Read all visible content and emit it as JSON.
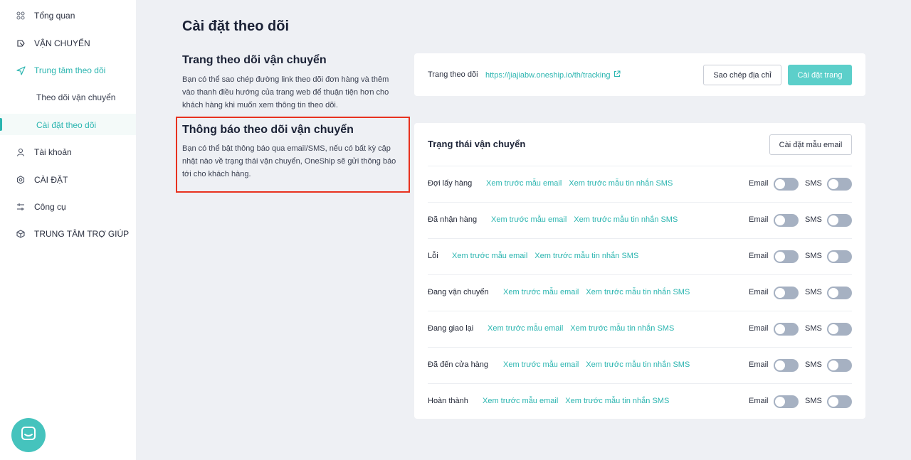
{
  "sidebar": {
    "items": [
      {
        "label": "Tổng quan",
        "icon": "grid-icon"
      },
      {
        "label": "VẬN CHUYỂN",
        "icon": "truck-icon"
      },
      {
        "label": "Trung tâm theo dõi",
        "icon": "send-icon"
      },
      {
        "label": "Tài khoản",
        "icon": "user-icon"
      },
      {
        "label": "CÀI ĐẶT",
        "icon": "settings-icon"
      },
      {
        "label": "Công cụ",
        "icon": "tools-icon"
      },
      {
        "label": "TRUNG TÂM TRỢ GIÚP",
        "icon": "box-icon"
      }
    ],
    "sub_items": [
      {
        "label": "Theo dõi vận chuyển"
      },
      {
        "label": "Cài đặt theo dõi",
        "active": true
      }
    ]
  },
  "page": {
    "title": "Cài đặt theo dõi"
  },
  "tracking_page": {
    "title": "Trang theo dõi vận chuyển",
    "description": "Bạn có thể sao chép đường link theo dõi đơn hàng và thêm vào thanh điều hướng của trang web để thuận tiện hơn cho khách hàng khi muốn xem thông tin theo dõi.",
    "label": "Trang theo dõi",
    "url": "https://jiajiabw.oneship.io/th/tracking",
    "copy_button": "Sao chép địa chỉ",
    "setup_button": "Cài đặt trang"
  },
  "notification": {
    "title": "Thông báo theo dõi vận chuyển",
    "description": "Bạn có thể bật thông báo qua email/SMS, nếu có bất kỳ cập nhật nào về trạng thái vận chuyển, OneShip sẽ gửi thông báo tới cho khách hàng.",
    "status_title": "Trạng thái vận chuyển",
    "template_button": "Cài đặt mẫu email",
    "email_preview": "Xem trước mẫu email",
    "sms_preview": "Xem trước mẫu tin nhắn SMS",
    "email_label": "Email",
    "sms_label": "SMS",
    "statuses": [
      {
        "name": "Đợi lấy hàng",
        "email_on": false,
        "sms_on": false
      },
      {
        "name": "Đã nhận hàng",
        "email_on": false,
        "sms_on": false
      },
      {
        "name": "Lỗi",
        "email_on": false,
        "sms_on": false
      },
      {
        "name": "Đang vận chuyển",
        "email_on": false,
        "sms_on": false
      },
      {
        "name": "Đang giao lại",
        "email_on": false,
        "sms_on": false
      },
      {
        "name": "Đã đến cửa hàng",
        "email_on": false,
        "sms_on": false
      },
      {
        "name": "Hoàn thành",
        "email_on": false,
        "sms_on": false
      }
    ]
  },
  "chat": {
    "icon": "chat-icon"
  },
  "colors": {
    "accent": "#2bb5b0",
    "button_teal": "#5ccfca",
    "highlight": "#e8321f",
    "toggle_off": "#a6b1c2"
  }
}
